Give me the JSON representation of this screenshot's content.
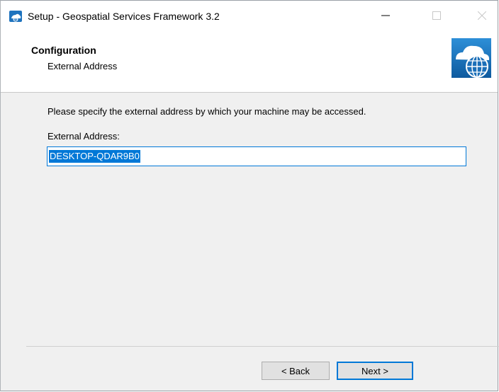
{
  "window": {
    "title": "Setup - Geospatial Services Framework 3.2",
    "icons": {
      "app": "globe-cloud-icon",
      "minimize": "minimize-icon",
      "maximize": "maximize-icon",
      "close": "close-icon"
    }
  },
  "header": {
    "title": "Configuration",
    "subtitle": "External Address",
    "logo_icon": "cloud-globe-icon"
  },
  "content": {
    "instruction": "Please specify the external address by which your machine may be accessed.",
    "field_label": "External Address:",
    "field_value": "DESKTOP-QDAR9B0"
  },
  "buttons": {
    "back": "< Back",
    "next": "Next >"
  },
  "colors": {
    "accent": "#0078d7",
    "window_bg": "#f0f0f0",
    "header_bg": "#ffffff"
  }
}
